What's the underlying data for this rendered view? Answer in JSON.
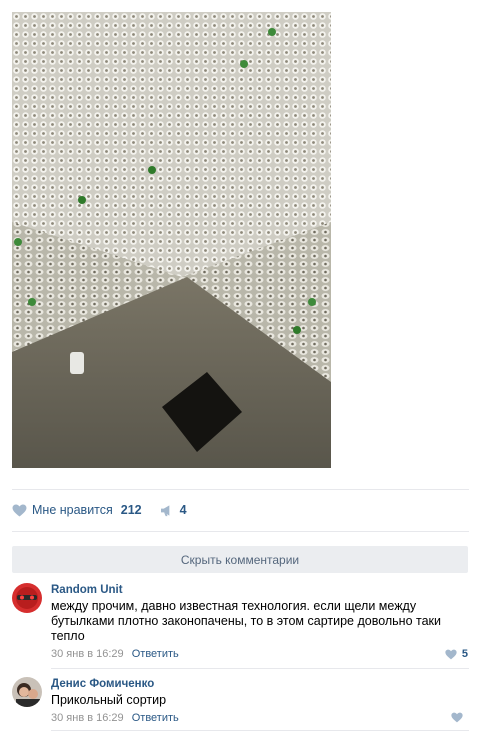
{
  "actions": {
    "like_label": "Мне нравится",
    "like_count": "212",
    "share_count": "4"
  },
  "hide_comments_label": "Скрыть комментарии",
  "comments": [
    {
      "author": "Random Unit",
      "text": "между прочим, давно известная технология. если щели между бутылками плотно законопачены, то в этом сартире довольно таки тепло",
      "date": "30 янв в 16:29",
      "reply_label": "Ответить",
      "likes": "5"
    },
    {
      "author": "Денис Фомиченко",
      "text": "Прикольный сортир",
      "date": "30 янв в 16:29",
      "reply_label": "Ответить",
      "likes": ""
    }
  ],
  "colors": {
    "link": "#2a5885",
    "icon": "#a3b7cc",
    "divider": "#e7e8ec",
    "button_bg": "#ebedf0",
    "meta": "#939393"
  }
}
